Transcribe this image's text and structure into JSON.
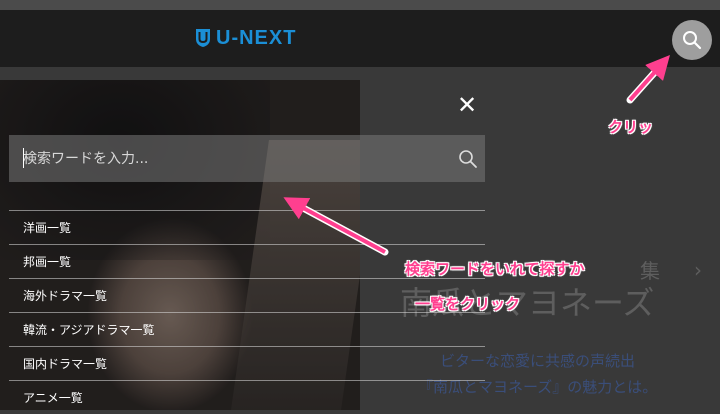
{
  "header": {
    "logo_text": "U-NEXT",
    "brand_color": "#1b8fd6",
    "search_button_icon": "search-icon"
  },
  "overlay": {
    "close_icon": "close-icon",
    "search": {
      "placeholder": "検索ワードを入力...",
      "icon": "search-icon"
    },
    "menu_items": [
      {
        "label": "洋画一覧"
      },
      {
        "label": "邦画一覧"
      },
      {
        "label": "海外ドラマ一覧"
      },
      {
        "label": "韓流・アジアドラマ一覧"
      },
      {
        "label": "国内ドラマ一覧"
      },
      {
        "label": "アニメ一覧"
      }
    ]
  },
  "background": {
    "feature_kanji": "集",
    "feature_title": "南瓜とマヨネーズ",
    "subtitle_line1": "ビターな恋愛に共感の声続出",
    "subtitle_line2": "『南瓜とマヨネーズ』の魅力とは。"
  },
  "annotations": {
    "click_label": "クリッ",
    "search_label": "検索ワードをいれて探すか",
    "list_label": "一覧をクリック",
    "color": "#ff3f8f"
  }
}
